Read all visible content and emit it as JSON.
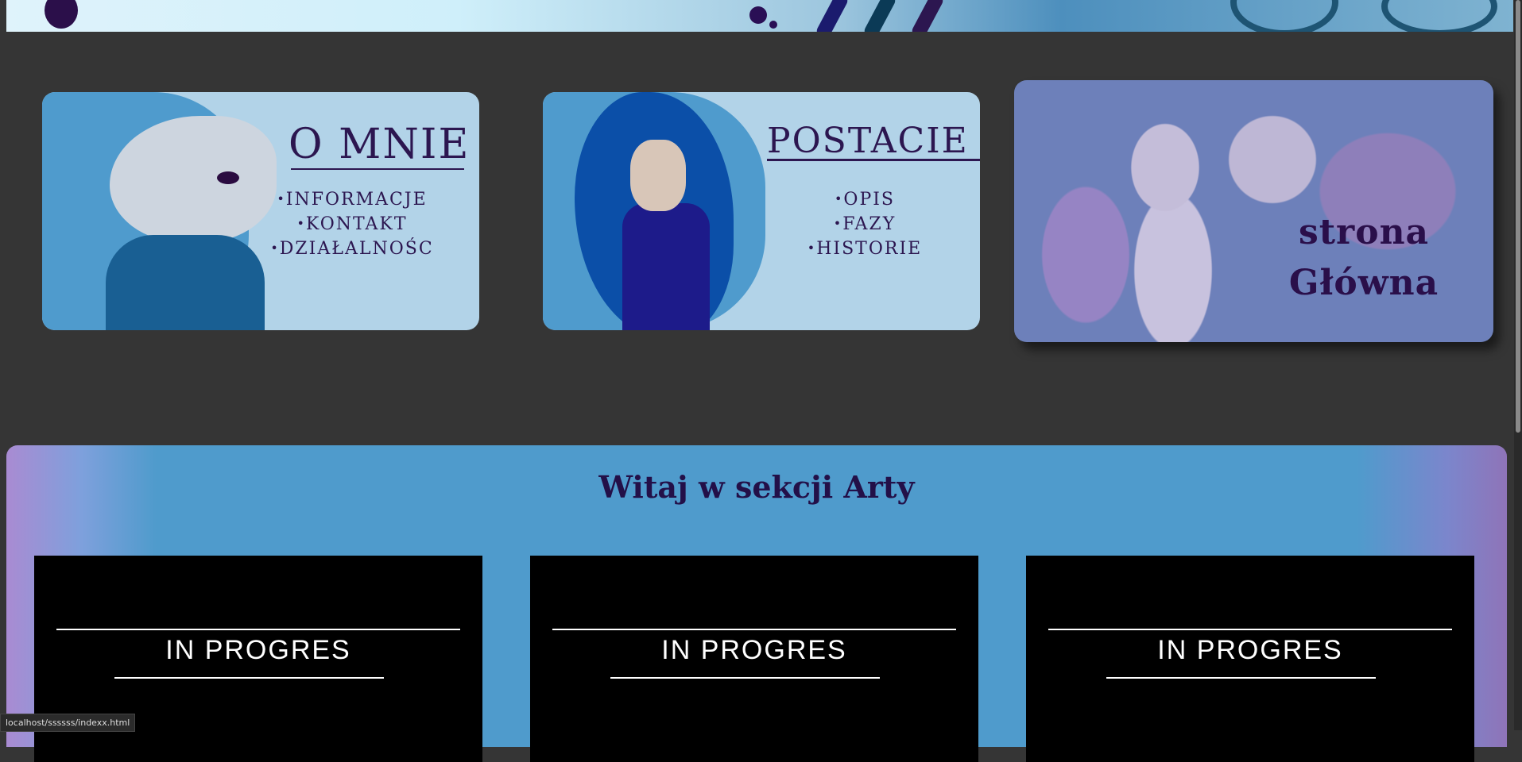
{
  "nav_cards": {
    "about": {
      "title": "O MNIE",
      "items": [
        "INFORMACJE",
        "KONTAKT",
        "DZIAŁALNOŚC"
      ]
    },
    "characters": {
      "title": "POSTACIE",
      "items": [
        "OPIS",
        "FAZY",
        "HISTORIE"
      ]
    },
    "home": {
      "title_line1": "strona",
      "title_line2": "Główna"
    }
  },
  "art_section": {
    "title": "Witaj w sekcji Arty",
    "tiles": [
      "IN PROGRES",
      "IN PROGRES",
      "IN PROGRES"
    ]
  },
  "status_bar": {
    "url": "localhost/ssssss/indexx.html"
  },
  "colors": {
    "page_bg": "#353535",
    "card_bg": "#b2d3e8",
    "accent_dark": "#2c1650",
    "section_bg": "#4f9bcc"
  }
}
